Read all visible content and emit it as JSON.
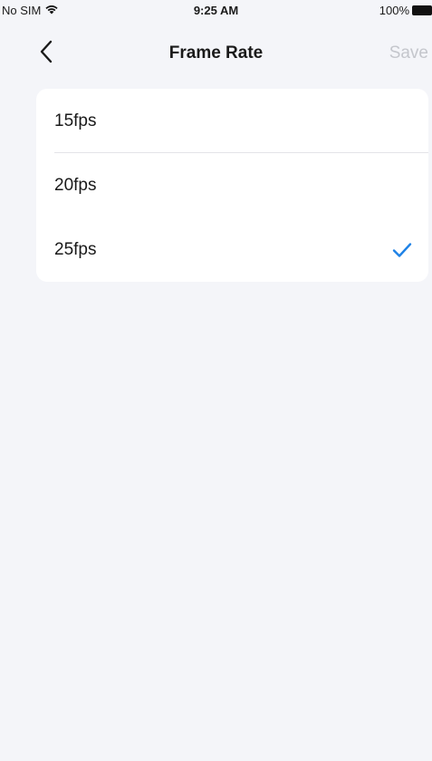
{
  "status_bar": {
    "carrier": "No SIM",
    "time": "9:25 AM",
    "battery": "100%",
    "wifi_icon": "wifi-icon",
    "battery_icon": "battery-icon"
  },
  "nav": {
    "title": "Frame Rate",
    "save_label": "Save",
    "back_icon": "chevron-left-icon"
  },
  "options": [
    {
      "label": "15fps",
      "selected": false
    },
    {
      "label": "20fps",
      "selected": false
    },
    {
      "label": "25fps",
      "selected": true
    }
  ],
  "colors": {
    "background": "#f4f5f9",
    "card": "#ffffff",
    "accent": "#1f82e6",
    "save_disabled": "#c4c6cc",
    "divider": "#e3e4e8"
  },
  "check_icon": "checkmark-icon"
}
